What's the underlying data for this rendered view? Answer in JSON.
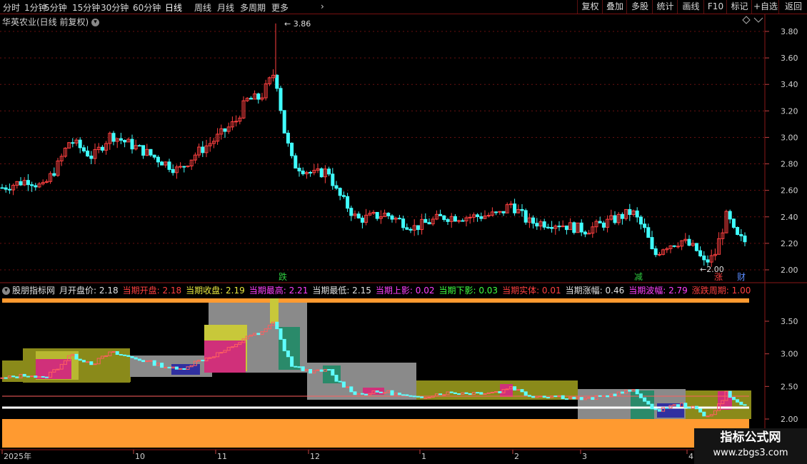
{
  "toolbar": {
    "periods": [
      "分时",
      "1分钟",
      "5分钟",
      "15分钟",
      "30分钟",
      "60分钟",
      "日线",
      "周线",
      "月线",
      "多周期",
      "更多"
    ],
    "active_period": "日线",
    "right_buttons": [
      "复权",
      "叠加",
      "多股",
      "统计",
      "画线",
      "F10",
      "标记",
      "+自选",
      "返回"
    ]
  },
  "stock": {
    "title": "华英农业(日线 前复权)",
    "high_label": "3.86",
    "low_label": "2.00"
  },
  "price_axis": {
    "ticks": [
      "3.80",
      "3.60",
      "3.40",
      "3.20",
      "3.00",
      "2.80",
      "2.60",
      "2.40",
      "2.20",
      "2.00"
    ],
    "min": 1.95,
    "max": 3.92
  },
  "signals": [
    {
      "text": "跌",
      "color": "#2ecc40"
    },
    {
      "text": "减",
      "color": "#2ecc40"
    },
    {
      "text": "涨",
      "color": "#ff4040"
    },
    {
      "text": "财",
      "color": "#5a8cff"
    }
  ],
  "indicator": {
    "name": "股朋指标网",
    "fields": [
      {
        "label": "月开盘价:",
        "value": "2.18",
        "color": "#e0e0e0"
      },
      {
        "label": "当期开盘:",
        "value": "2.18",
        "color": "#ff4040"
      },
      {
        "label": "当期收盘:",
        "value": "2.19",
        "color": "#e8e840"
      },
      {
        "label": "当期最高:",
        "value": "2.21",
        "color": "#ff40ff"
      },
      {
        "label": "当期最低:",
        "value": "2.15",
        "color": "#e0e0e0"
      },
      {
        "label": "当期上影:",
        "value": "0.02",
        "color": "#ff40ff"
      },
      {
        "label": "当期下影:",
        "value": "0.03",
        "color": "#40ff40"
      },
      {
        "label": "当期实体:",
        "value": "0.01",
        "color": "#ff4040"
      },
      {
        "label": "当期涨幅:",
        "value": "0.46",
        "color": "#e0e0e0"
      },
      {
        "label": "当期波幅:",
        "value": "2.79",
        "color": "#ff40ff"
      },
      {
        "label": "涨跌周期:",
        "value": "1.00",
        "color": "#ff4040"
      }
    ]
  },
  "indicator_axis": {
    "ticks": [
      "3.50",
      "3.00",
      "2.50",
      "2.00"
    ],
    "min": 1.78,
    "max": 3.92
  },
  "time_axis": [
    "2025年",
    "10",
    "11",
    "12",
    "1",
    "2",
    "3",
    "4"
  ],
  "colors": {
    "up": "#ff4040",
    "down": "#40ffff",
    "grid": "#6a1010",
    "orange": "#ff9a30"
  },
  "watermark": {
    "line1": "指标公式网",
    "line2": "www.zbgs3.com"
  }
}
